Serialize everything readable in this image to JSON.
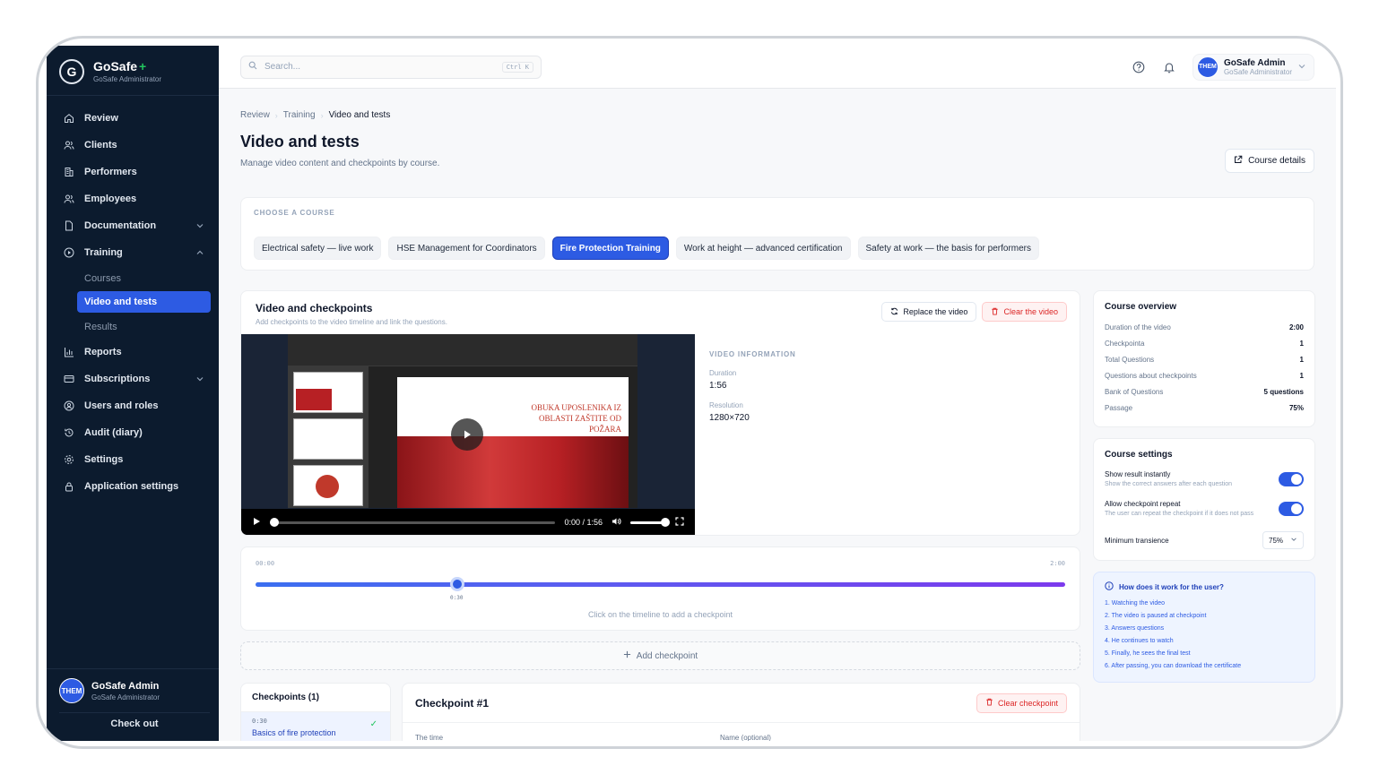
{
  "brand": {
    "name": "GoSafe",
    "plus": "+",
    "sub": "GoSafe Administrator"
  },
  "sidebar": {
    "items": [
      {
        "label": "Review",
        "icon": "home-icon"
      },
      {
        "label": "Clients",
        "icon": "users-icon"
      },
      {
        "label": "Performers",
        "icon": "building-icon"
      },
      {
        "label": "Employees",
        "icon": "users-icon"
      },
      {
        "label": "Documentation",
        "icon": "file-icon"
      },
      {
        "label": "Training",
        "icon": "play-circle-icon"
      },
      {
        "label": "Reports",
        "icon": "bar-chart-icon"
      },
      {
        "label": "Subscriptions",
        "icon": "credit-card-icon"
      },
      {
        "label": "Users and roles",
        "icon": "shield-icon"
      },
      {
        "label": "Audit (diary)",
        "icon": "history-icon"
      },
      {
        "label": "Settings",
        "icon": "gear-icon"
      },
      {
        "label": "Application settings",
        "icon": "lock-icon"
      }
    ],
    "training_sub": [
      "Courses",
      "Video and tests",
      "Results"
    ],
    "user": {
      "avatar": "THEM",
      "name": "GoSafe Admin",
      "role": "GoSafe Administrator"
    },
    "checkout": "Check out"
  },
  "topbar": {
    "search_placeholder": "Search...",
    "shortcut": "Ctrl K",
    "profile": {
      "avatar": "THEM",
      "name": "GoSafe Admin",
      "role": "GoSafe Administrator"
    }
  },
  "breadcrumb": [
    "Review",
    "Training",
    "Video and tests"
  ],
  "page": {
    "title": "Video and tests",
    "subtitle": "Manage video content and checkpoints by course.",
    "course_details": "Course details"
  },
  "courses": {
    "label": "CHOOSE A COURSE",
    "items": [
      "Electrical safety — live work",
      "HSE Management for Coordinators",
      "Fire Protection Training",
      "Work at height — advanced certification",
      "Safety at work — the basis for performers"
    ],
    "active_index": 2
  },
  "video_panel": {
    "title": "Video and checkpoints",
    "subtitle": "Add checkpoints to the video timeline and link the questions.",
    "replace": "Replace the video",
    "clear": "Clear the video",
    "slide_text": "OBUKA UPOSLENIKA IZ OBLASTI ZAŠTITE OD POŽARA",
    "player_time": "0:00 / 1:56",
    "info_heading": "VIDEO INFORMATION",
    "duration_label": "Duration",
    "duration": "1:56",
    "resolution_label": "Resolution",
    "resolution": "1280×720"
  },
  "timeline": {
    "start": "00:00",
    "end": "2:00",
    "marker": "0:30",
    "hint": "Click on the timeline to add a checkpoint"
  },
  "add_checkpoint": "Add checkpoint",
  "checkpoints": {
    "title": "Checkpoints (1)",
    "items": [
      {
        "time": "0:30",
        "name": "Basics of fire protection"
      }
    ]
  },
  "checkpoint_detail": {
    "title": "Checkpoint #1",
    "clear": "Clear checkpoint",
    "time_label": "The time",
    "name_label": "Name (optional)"
  },
  "overview": {
    "title": "Course overview",
    "stats": [
      {
        "label": "Duration of the video",
        "value": "2:00"
      },
      {
        "label": "Checkpointa",
        "value": "1"
      },
      {
        "label": "Total Questions",
        "value": "1"
      },
      {
        "label": "Questions about checkpoints",
        "value": "1"
      },
      {
        "label": "Bank of Questions",
        "value": "5 questions"
      },
      {
        "label": "Passage",
        "value": "75%"
      }
    ]
  },
  "settings": {
    "title": "Course settings",
    "items": [
      {
        "title": "Show result instantly",
        "desc": "Show the correct answers after each question",
        "on": true
      },
      {
        "title": "Allow checkpoint repeat",
        "desc": "The user can repeat the checkpoint if it does not pass",
        "on": true
      }
    ],
    "min_label": "Minimum transience",
    "min_value": "75%"
  },
  "help": {
    "title": "How does it work for the user?",
    "steps": [
      "1. Watching the video",
      "2. The video is paused at checkpoint",
      "3. Answers questions",
      "4. He continues to watch",
      "5. Finally, he sees the final test",
      "6. After passing, you can download the certificate"
    ]
  },
  "colors": {
    "accent": "#2d5be3",
    "sidebar": "#0c1b2e",
    "danger": "#dc2626"
  }
}
